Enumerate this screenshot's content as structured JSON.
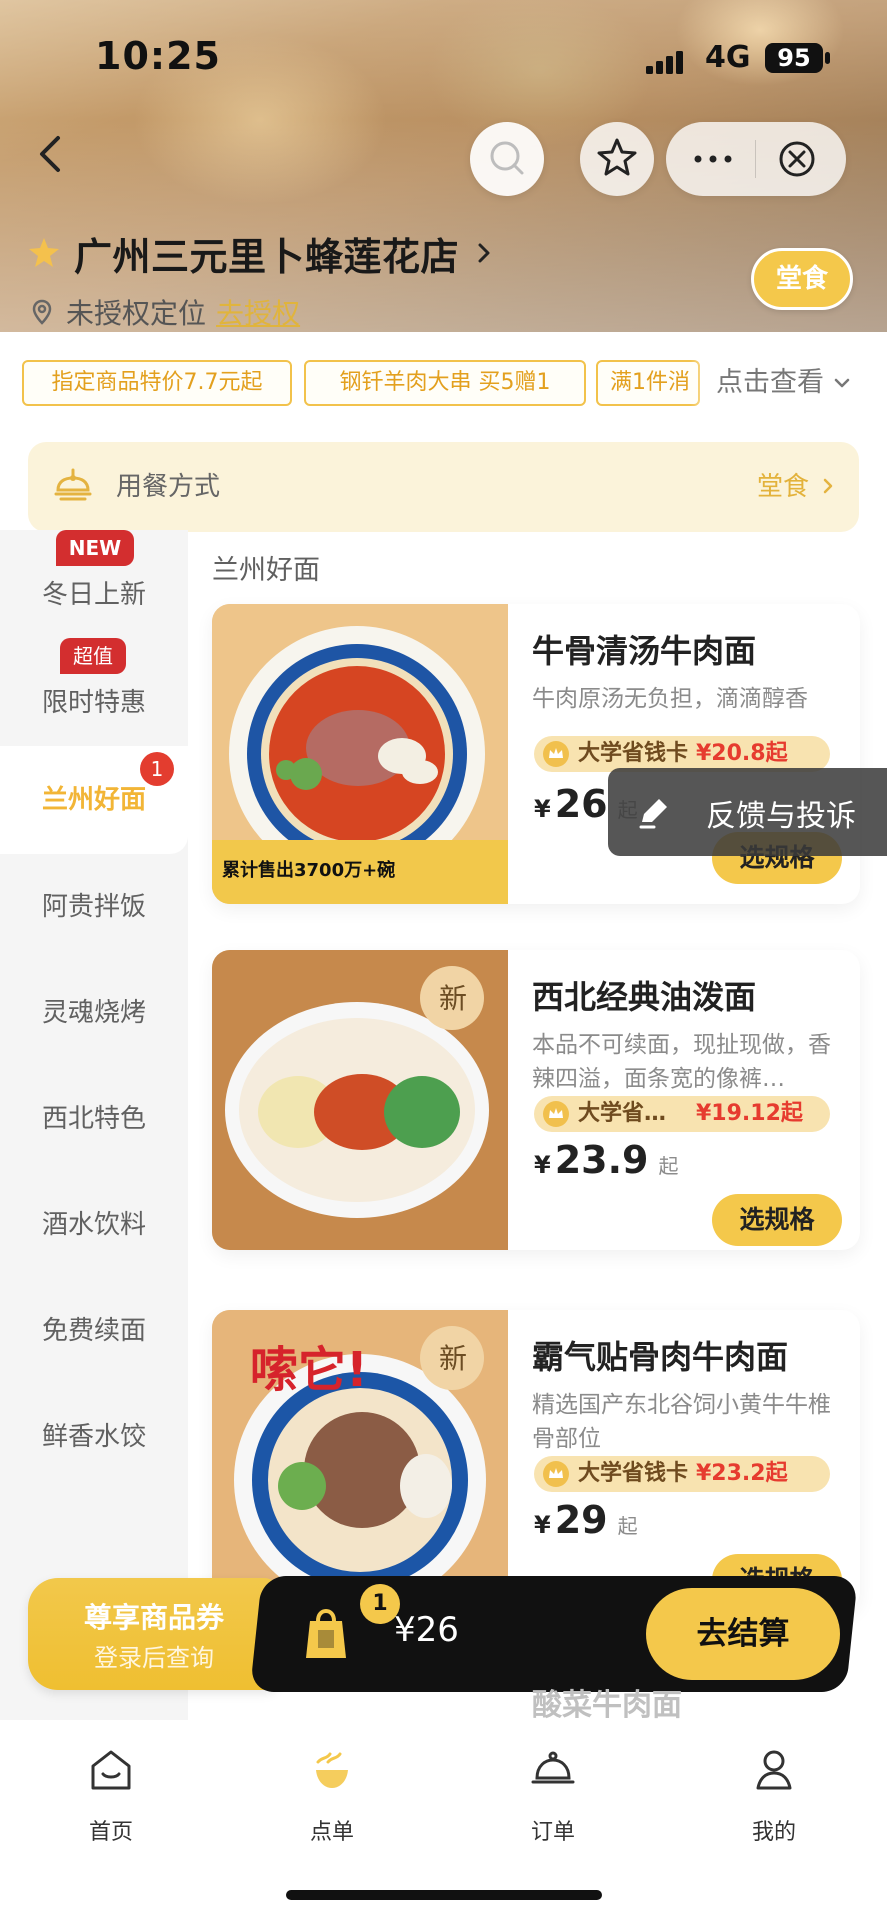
{
  "status_bar": {
    "time": "10:25",
    "network": "4G",
    "battery": "95"
  },
  "header": {
    "store_name": "广州三元里卜蜂莲花店",
    "dine_mode_pill": "堂食",
    "location_text": "未授权定位",
    "authorize_link": "去授权"
  },
  "promotions": {
    "tags": [
      "指定商品特价7.7元起",
      "钢钎羊肉大串 买5赠1",
      "满1件消"
    ],
    "view_more": "点击查看"
  },
  "dining": {
    "label": "用餐方式",
    "value": "堂食"
  },
  "sidebar": {
    "items": [
      {
        "label": "冬日上新",
        "badge": "NEW"
      },
      {
        "label": "限时特惠",
        "badge": "超值"
      },
      {
        "label": "兰州好面",
        "badge": "1"
      },
      {
        "label": "阿贵拌饭"
      },
      {
        "label": "灵魂烧烤"
      },
      {
        "label": "西北特色"
      },
      {
        "label": "酒水饮料"
      },
      {
        "label": "免费续面"
      },
      {
        "label": "鲜香水饺"
      }
    ]
  },
  "section": {
    "title": "兰州好面"
  },
  "products": [
    {
      "title": "牛骨清汤牛肉面",
      "desc": "牛肉原汤无负担，滴滴醇香",
      "member_text": "大学省钱卡",
      "member_price": "¥20.8起",
      "currency": "¥",
      "price": "26",
      "price_suffix": "起",
      "button": "选规格",
      "image_banner": "累计售出3700万+碗"
    },
    {
      "title": "西北经典油泼面",
      "desc": "本品不可续面，现扯现做，香辣四溢，面条宽的像裤…",
      "member_text": "大学省…",
      "member_price": "¥19.12起",
      "currency": "¥",
      "price": "23.9",
      "price_suffix": "起",
      "button": "选规格",
      "image_badge": "新"
    },
    {
      "title": "霸气贴骨肉牛肉面",
      "desc": "精选国产东北谷饲小黄牛牛椎骨部位",
      "member_text": "大学省钱卡",
      "member_price": "¥23.2起",
      "currency": "¥",
      "price": "29",
      "price_suffix": "起",
      "button": "选规格",
      "image_badge": "新",
      "image_title": "嗦它!"
    }
  ],
  "feedback": {
    "label": "反馈与投诉"
  },
  "coupon": {
    "line1": "尊享商品券",
    "line2": "登录后查询"
  },
  "cart": {
    "count": "1",
    "total": "¥26",
    "checkout": "去结算"
  },
  "behind_product_title": "酸菜牛肉面",
  "bottom_nav": {
    "items": [
      {
        "label": "首页"
      },
      {
        "label": "点单"
      },
      {
        "label": "订单"
      },
      {
        "label": "我的"
      }
    ]
  }
}
